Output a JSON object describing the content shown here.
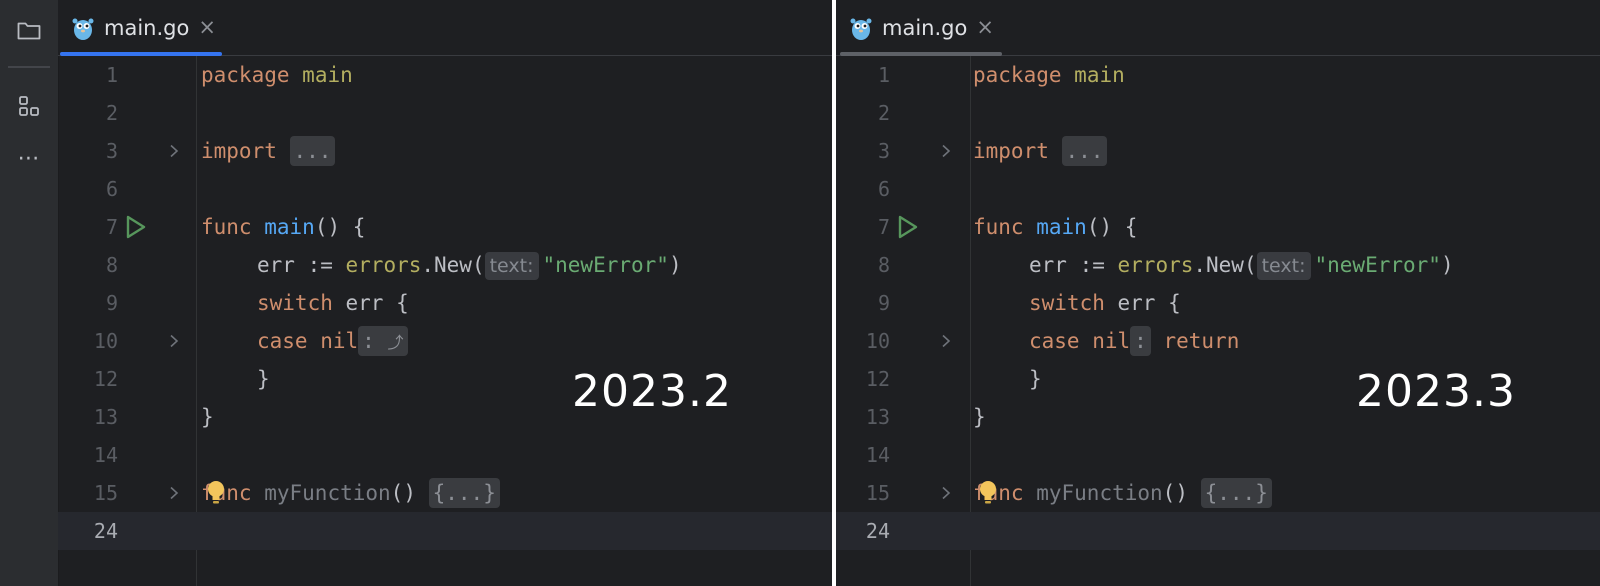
{
  "left": {
    "tab": {
      "label": "main.go",
      "close": "×",
      "icon": "gopher-icon"
    },
    "version_label": "2023.2",
    "sidebar": {
      "icons": [
        "folder-icon",
        "structure-icon",
        "more-icon"
      ],
      "more_glyph": "⋯"
    },
    "accent": "#3574f0",
    "lines": {
      "l1": "1",
      "l2": "2",
      "l3": "3",
      "l6": "6",
      "l7": "7",
      "l8": "8",
      "l9": "9",
      "l10": "10",
      "l12": "12",
      "l13": "13",
      "l14": "14",
      "l15": "15",
      "l24": "24"
    },
    "code": {
      "package_kw": "package",
      "package_name": "main",
      "import_kw": "import",
      "import_folded": "...",
      "func_kw": "func",
      "main_name": "main",
      "main_sig": "() {",
      "err_var": "err",
      "assign": " := ",
      "errors_pkg": "errors",
      "new_call": ".New(",
      "hint_label": "text:",
      "string_value": "\"newError\"",
      "close_paren": ")",
      "switch_kw": "switch",
      "switch_rest": " err {",
      "case_kw": "case",
      "nil_kw": "nil",
      "case_colon": ":",
      "return_glyph": "⤴",
      "close_brace_inner": "}",
      "close_brace_outer": "}",
      "func2_kw": "func",
      "my_function": "myFunction",
      "my_function_parens": "()",
      "body_folded": "{...}"
    }
  },
  "right": {
    "tab": {
      "label": "main.go",
      "close": "×",
      "icon": "gopher-icon"
    },
    "version_label": "2023.3",
    "accent": "#6f737a",
    "lines": {
      "l1": "1",
      "l2": "2",
      "l3": "3",
      "l6": "6",
      "l7": "7",
      "l8": "8",
      "l9": "9",
      "l10": "10",
      "l12": "12",
      "l13": "13",
      "l14": "14",
      "l15": "15",
      "l24": "24"
    },
    "code": {
      "package_kw": "package",
      "package_name": "main",
      "import_kw": "import",
      "import_folded": "...",
      "func_kw": "func",
      "main_name": "main",
      "main_sig": "() {",
      "err_var": "err",
      "assign": " := ",
      "errors_pkg": "errors",
      "new_call": ".New(",
      "hint_label": "text:",
      "string_value": "\"newError\"",
      "close_paren": ")",
      "switch_kw": "switch",
      "switch_rest": " err {",
      "case_kw": "case",
      "nil_kw": "nil",
      "case_colon": ":",
      "return_kw": "return",
      "close_brace_inner": "}",
      "close_brace_outer": "}",
      "func2_kw": "func",
      "my_function": "myFunction",
      "my_function_parens": "()",
      "body_folded": "{...}"
    }
  }
}
